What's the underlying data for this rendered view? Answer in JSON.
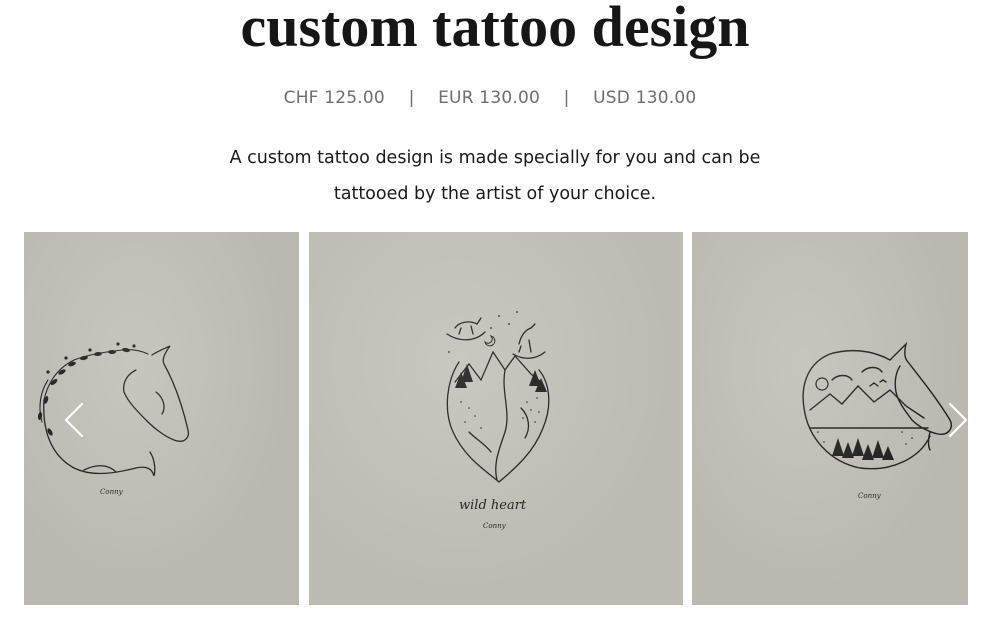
{
  "product": {
    "title": "custom tattoo design",
    "prices": {
      "chf": "CHF 125.00",
      "separator": "|",
      "eur": "EUR 130.00",
      "usd": "USD 130.00"
    },
    "description": {
      "line1": "A custom tattoo design is made specially for you and can be",
      "line2": "tattooed by the artist of your choice."
    }
  },
  "gallery": {
    "prev_icon": "chevron-left-icon",
    "next_icon": "chevron-right-icon",
    "slides": [
      {
        "subject": "horse head line drawing with flowering vine",
        "signature": "Conny"
      },
      {
        "subject": "heart-shaped mountains with horses and pine trees",
        "caption": "wild heart",
        "signature": "Conny"
      },
      {
        "subject": "horse head circle with mountain landscape and birds",
        "signature": "Conny"
      }
    ],
    "colors": {
      "paper": "#c2bfb8",
      "ink": "#1e1e1e"
    }
  }
}
